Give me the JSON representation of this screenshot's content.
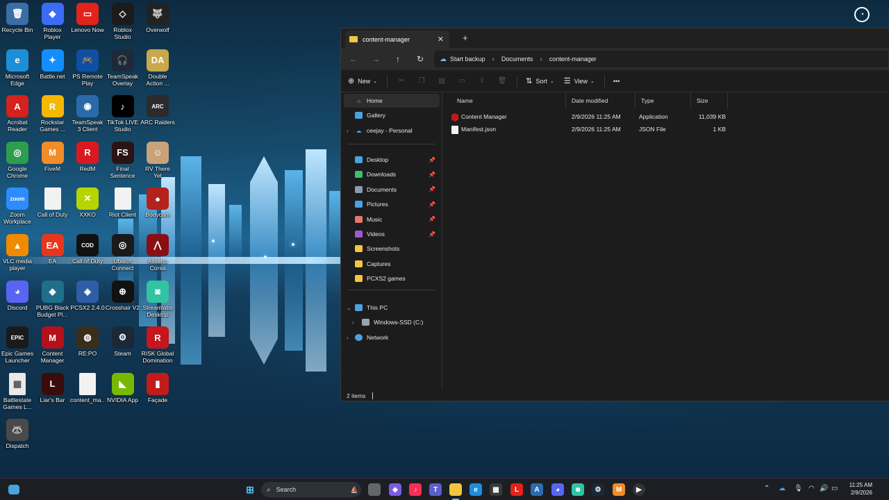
{
  "desktop": {
    "icons": [
      {
        "label": "Recycle Bin",
        "icon": "recycle-bin-icon",
        "color": "#3a6ea5",
        "glyph": "🗑"
      },
      {
        "label": "Roblox Player",
        "icon": "roblox-icon",
        "color": "#3b6cf5",
        "glyph": "◆"
      },
      {
        "label": "Lenovo Now",
        "icon": "lenovo-icon",
        "color": "#e2231a",
        "glyph": "▭"
      },
      {
        "label": "Roblox Studio",
        "icon": "roblox-studio-icon",
        "color": "#1b1b1b",
        "glyph": "◇"
      },
      {
        "label": "Overwolf",
        "icon": "overwolf-icon",
        "color": "#222",
        "glyph": "🐺"
      },
      {
        "label": "Microsoft Edge",
        "icon": "edge-icon",
        "color": "#1d8fd8",
        "glyph": "e"
      },
      {
        "label": "Battle.net",
        "icon": "battlenet-icon",
        "color": "#148eff",
        "glyph": "✦"
      },
      {
        "label": "PS Remote Play",
        "icon": "ps-remote-icon",
        "color": "#0d4fa3",
        "glyph": "🎮"
      },
      {
        "label": "TeamSpeak Overlay",
        "icon": "teamspeak-overlay-icon",
        "color": "#1e2a3a",
        "glyph": "🎧"
      },
      {
        "label": "Double Action ...",
        "icon": "double-action-icon",
        "color": "#c8a84a",
        "glyph": "DA"
      },
      {
        "label": "Acrobat Reader",
        "icon": "acrobat-icon",
        "color": "#d4221c",
        "glyph": "A"
      },
      {
        "label": "Rockstar Games ...",
        "icon": "rockstar-icon",
        "color": "#f5b800",
        "glyph": "R"
      },
      {
        "label": "TeamSpeak 3 Client",
        "icon": "teamspeak-icon",
        "color": "#2a6aa8",
        "glyph": "◉"
      },
      {
        "label": "TikTok LIVE Studio",
        "icon": "tiktok-icon",
        "color": "#000",
        "glyph": "♪"
      },
      {
        "label": "ARC Raiders",
        "icon": "arc-raiders-icon",
        "color": "#2b2b2b",
        "glyph": "ARC"
      },
      {
        "label": "Google Chrome",
        "icon": "chrome-icon",
        "color": "#2e9d4e",
        "glyph": "◎"
      },
      {
        "label": "FiveM",
        "icon": "fivem-icon",
        "color": "#f28c28",
        "glyph": "M"
      },
      {
        "label": "RedM",
        "icon": "redm-icon",
        "color": "#d9181f",
        "glyph": "R"
      },
      {
        "label": "Final Sentence",
        "icon": "final-sentence-icon",
        "color": "#2a1414",
        "glyph": "FS"
      },
      {
        "label": "RV There Yet",
        "icon": "rv-there-yet-icon",
        "color": "#c9a27a",
        "glyph": "☺"
      },
      {
        "label": "Zoom Workplace",
        "icon": "zoom-icon",
        "color": "#2d8cff",
        "glyph": "zoom"
      },
      {
        "label": "Call of Duty",
        "icon": "call-of-duty-file-icon",
        "color": "#f2f2f2",
        "glyph": ""
      },
      {
        "label": "XXKO",
        "icon": "xxko-icon",
        "color": "#b6d400",
        "glyph": "✕"
      },
      {
        "label": "Riot Client",
        "icon": "riot-client-file-icon",
        "color": "#f2f2f2",
        "glyph": ""
      },
      {
        "label": "Bodycam",
        "icon": "bodycam-icon",
        "color": "#b3221c",
        "glyph": "●"
      },
      {
        "label": "VLC media player",
        "icon": "vlc-icon",
        "color": "#f08a00",
        "glyph": "▲"
      },
      {
        "label": "EA",
        "icon": "ea-icon",
        "color": "#e8361e",
        "glyph": "EA"
      },
      {
        "label": "Call of Duty",
        "icon": "call-of-duty-icon",
        "color": "#111",
        "glyph": "COD"
      },
      {
        "label": "Ubisoft Connect",
        "icon": "ubisoft-icon",
        "color": "#1a1a1a",
        "glyph": "◎"
      },
      {
        "label": "Assetto Corsa",
        "icon": "assetto-corsa-icon",
        "color": "#8a0f14",
        "glyph": "⋀"
      },
      {
        "label": "Discord",
        "icon": "discord-icon",
        "color": "#5865f2",
        "glyph": "◕"
      },
      {
        "label": "PUBG Black Budget Pl...",
        "icon": "pubg-icon",
        "color": "#1f6f8b",
        "glyph": "◆"
      },
      {
        "label": "PCSX2 2.4.0",
        "icon": "pcsx2-icon",
        "color": "#2f5da8",
        "glyph": "◈"
      },
      {
        "label": "Crosshair V2",
        "icon": "crosshair-icon",
        "color": "#111",
        "glyph": "⊕"
      },
      {
        "label": "Streamlabs Desktop",
        "icon": "streamlabs-icon",
        "color": "#31c3a2",
        "glyph": "◙"
      },
      {
        "label": "Epic Games Launcher",
        "icon": "epic-games-icon",
        "color": "#1a1a1a",
        "glyph": "EPIC"
      },
      {
        "label": "Content Manager",
        "icon": "content-manager-icon",
        "color": "#b3121a",
        "glyph": "M"
      },
      {
        "label": "RE:PO",
        "icon": "repo-icon",
        "color": "#3a2e1a",
        "glyph": "◍"
      },
      {
        "label": "Steam",
        "icon": "steam-icon",
        "color": "#1b2838",
        "glyph": "⚙"
      },
      {
        "label": "RISK Global Domination",
        "icon": "risk-icon",
        "color": "#c4161c",
        "glyph": "R"
      },
      {
        "label": "Battlestate Games L...",
        "icon": "battlestate-icon",
        "color": "#e9e9e9",
        "glyph": "▦"
      },
      {
        "label": "Liar's Bar",
        "icon": "liars-bar-icon",
        "color": "#3b0c0c",
        "glyph": "L"
      },
      {
        "label": "content_ma...",
        "icon": "text-file-icon",
        "color": "#f2f2f2",
        "glyph": ""
      },
      {
        "label": "NVIDIA App",
        "icon": "nvidia-icon",
        "color": "#76b900",
        "glyph": "◣"
      },
      {
        "label": "Façade",
        "icon": "facade-icon",
        "color": "#c21b1b",
        "glyph": "▮"
      },
      {
        "label": "Dispatch",
        "icon": "dispatch-icon",
        "color": "#4a4a4a",
        "glyph": "🦝"
      }
    ]
  },
  "explorer": {
    "tab_title": "content-manager",
    "breadcrumb": [
      "Start backup",
      "Documents",
      "content-manager"
    ],
    "toolbar": {
      "new": "New",
      "sort": "Sort",
      "view": "View",
      "more": "•••"
    },
    "nav": {
      "home": "Home",
      "gallery": "Gallery",
      "onedrive": "ceejay - Personal",
      "quick": [
        {
          "label": "Desktop",
          "color": "#4aa3df"
        },
        {
          "label": "Downloads",
          "color": "#3fbf6b"
        },
        {
          "label": "Documents",
          "color": "#8a9bb0"
        },
        {
          "label": "Pictures",
          "color": "#4aa3df"
        },
        {
          "label": "Music",
          "color": "#e5766a"
        },
        {
          "label": "Videos",
          "color": "#9b59d0"
        },
        {
          "label": "Screenshots",
          "color": "#f5c542"
        },
        {
          "label": "Captures",
          "color": "#f5c542"
        },
        {
          "label": "PCXS2 games",
          "color": "#f5c542"
        }
      ],
      "this_pc": "This PC",
      "drive": "Windows-SSD (C:)",
      "network": "Network"
    },
    "columns": {
      "name": "Name",
      "date": "Date modified",
      "type": "Type",
      "size": "Size"
    },
    "files": [
      {
        "name": "Content Manager",
        "date": "2/9/2026 11:25 AM",
        "type": "Application",
        "size": "11,039 KB"
      },
      {
        "name": "Manifest.json",
        "date": "2/9/2026 11:25 AM",
        "type": "JSON File",
        "size": "1 KB"
      }
    ],
    "status": "2 items"
  },
  "taskbar": {
    "search_placeholder": "Search",
    "time": "11:25 AM",
    "date": "2/9/2026"
  }
}
